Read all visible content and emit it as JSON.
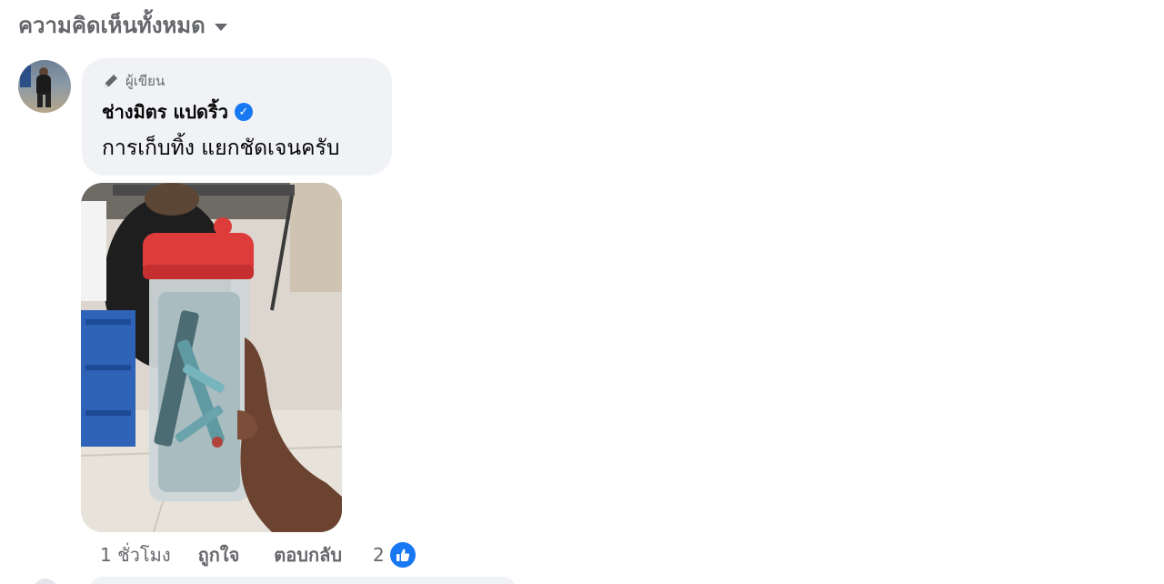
{
  "filter": {
    "label": "ความคิดเห็นทั้งหมด",
    "icon": "caret-down-icon"
  },
  "comment": {
    "badge": "ผู้เขียน",
    "badge_icon": "pencil-icon",
    "author": "ช่างมิตร แปดริ้ว",
    "verified_icon": "verified-badge-icon",
    "text": "การเก็บทิ้ง แยกชัดเจนครับ",
    "time": "1 ชั่วโมง",
    "like_label": "ถูกใจ",
    "reply_label": "ตอบกลับ",
    "reaction_count": "2",
    "reaction_icon": "like-thumb-icon"
  },
  "colors": {
    "accent": "#1877f2",
    "bubble_bg": "#f0f2f5",
    "secondary_text": "#65676b"
  }
}
